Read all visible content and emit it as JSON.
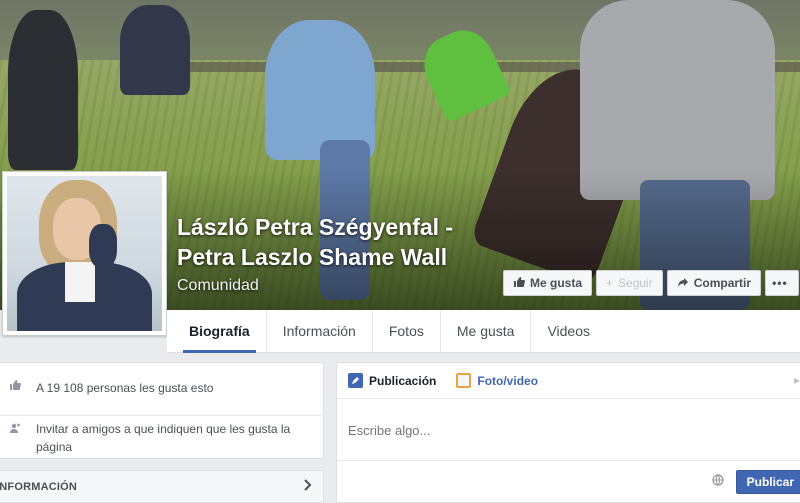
{
  "page": {
    "title_line1": "László Petra Szégyenfal -",
    "title_line2": "Petra Laszlo Shame Wall",
    "category": "Comunidad"
  },
  "cover_buttons": {
    "like": "Me gusta",
    "follow": "Seguir",
    "share": "Compartir",
    "more": "•••"
  },
  "tabs": [
    {
      "label": "Biografía",
      "active": true
    },
    {
      "label": "Información",
      "active": false
    },
    {
      "label": "Fotos",
      "active": false
    },
    {
      "label": "Me gusta",
      "active": false
    },
    {
      "label": "Videos",
      "active": false
    }
  ],
  "sidebar": {
    "likes_text": "A 19 108 personas les gusta esto",
    "invite_text": "Invitar a amigos a que indiquen que les gusta la página",
    "info_label": "INFORMACIÓN"
  },
  "composer": {
    "tab_post": "Publicación",
    "tab_photo": "Foto/video",
    "placeholder": "Escribe algo...",
    "publish": "Publicar"
  },
  "icons": {
    "like": "thumbs-up-icon",
    "follow": "plus-icon",
    "share": "share-arrow-icon",
    "likes": "thumbs-up-icon",
    "invite": "add-person-icon",
    "info": "chevron-right-icon",
    "post": "pencil-icon",
    "photo": "photo-icon",
    "privacy": "globe-icon"
  },
  "colors": {
    "accent": "#4267b2",
    "background": "#e9ebee"
  }
}
